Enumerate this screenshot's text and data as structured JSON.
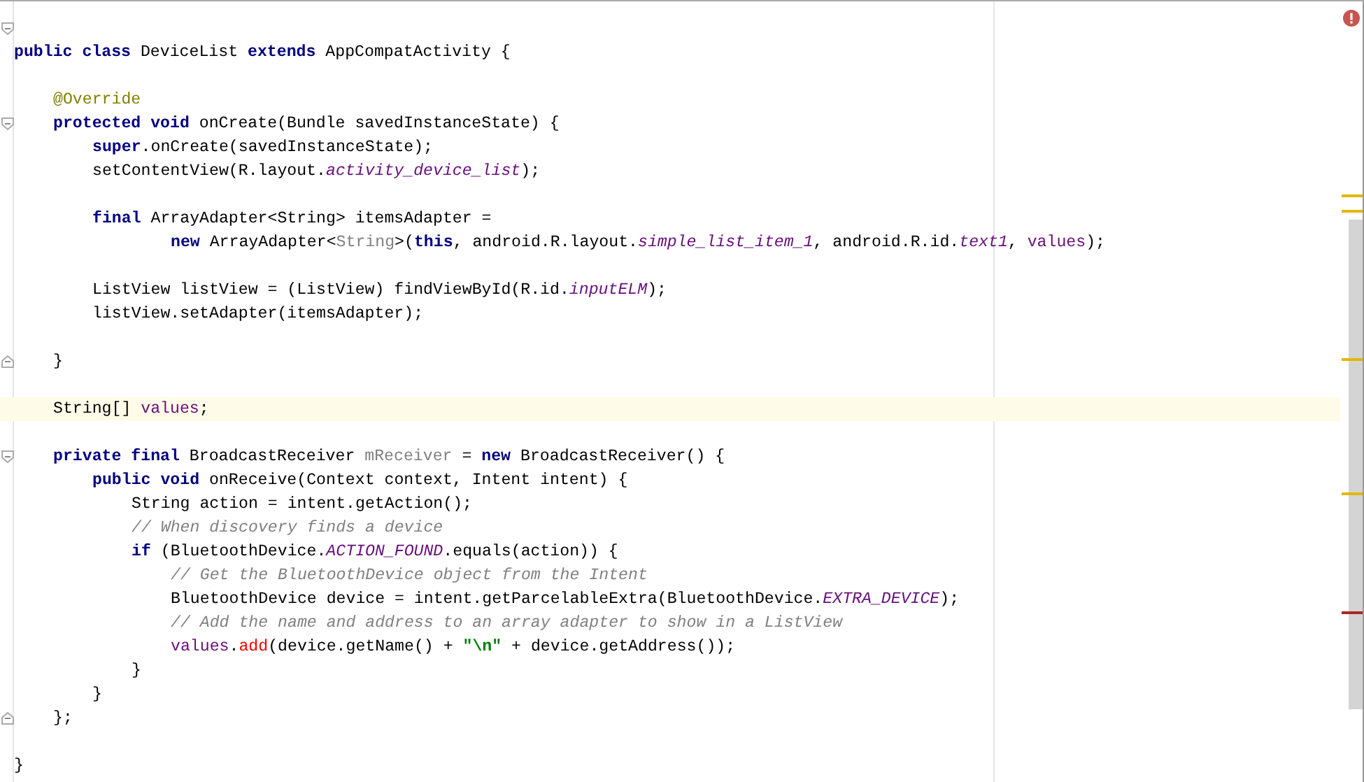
{
  "editor": {
    "lines": [
      {
        "kind": "opener",
        "current": false
      },
      {
        "kind": "code",
        "current": false,
        "tokens": [
          {
            "t": "public class ",
            "kind": "keyword"
          },
          {
            "t": "DeviceList ",
            "kind": "plain"
          },
          {
            "t": "extends ",
            "kind": "keyword"
          },
          {
            "t": "AppCompatActivity {",
            "kind": "plain"
          }
        ],
        "children": [
          {
            "kind": "blank",
            "current": false
          },
          {
            "kind": "code",
            "current": false,
            "tokens": [
              {
                "t": "@Override",
                "kind": "annotation"
              }
            ]
          },
          {
            "kind": "opener",
            "current": false,
            "tokens": [
              {
                "t": "protected void ",
                "kind": "keyword"
              },
              {
                "t": "onCreate(Bundle savedInstanceState) {",
                "kind": "plain"
              }
            ],
            "children": [
              {
                "kind": "code",
                "current": false,
                "tokens": [
                  {
                    "t": "super",
                    "kind": "keyword"
                  },
                  {
                    "t": ".onCreate(savedInstanceState);",
                    "kind": "plain"
                  }
                ]
              },
              {
                "kind": "code",
                "current": false,
                "tokens": [
                  {
                    "t": "setContentView(R.layout.",
                    "kind": "plain"
                  },
                  {
                    "t": "activity_device_list",
                    "kind": "static"
                  },
                  {
                    "t": ");",
                    "kind": "plain"
                  }
                ]
              },
              {
                "kind": "blank",
                "current": false
              },
              {
                "kind": "code",
                "current": false,
                "tokens": [
                  {
                    "t": "final ",
                    "kind": "keyword"
                  },
                  {
                    "t": "ArrayAdapter<String> itemsAdapter =",
                    "kind": "plain"
                  }
                ],
                "children": [
                  {
                    "kind": "continuation",
                    "current": false,
                    "tokens": [
                      {
                        "t": "new ",
                        "kind": "keyword"
                      },
                      {
                        "t": "ArrayAdapter<",
                        "kind": "plain"
                      },
                      {
                        "t": "String",
                        "kind": "muted"
                      },
                      {
                        "t": ">(",
                        "kind": "plain"
                      },
                      {
                        "t": "this",
                        "kind": "keyword"
                      },
                      {
                        "t": ", android.R.layout.",
                        "kind": "plain"
                      },
                      {
                        "t": "simple_list_item_1",
                        "kind": "static"
                      },
                      {
                        "t": ", android.R.id.",
                        "kind": "plain"
                      },
                      {
                        "t": "text1",
                        "kind": "static"
                      },
                      {
                        "t": ", ",
                        "kind": "plain"
                      },
                      {
                        "t": "values",
                        "kind": "field"
                      },
                      {
                        "t": ");",
                        "kind": "plain"
                      }
                    ]
                  }
                ]
              },
              {
                "kind": "blank",
                "current": false
              },
              {
                "kind": "code",
                "current": false,
                "tokens": [
                  {
                    "t": "ListView listView = (ListView) findViewById(R.id.",
                    "kind": "plain"
                  },
                  {
                    "t": "inputELM",
                    "kind": "static"
                  },
                  {
                    "t": ");",
                    "kind": "plain"
                  }
                ]
              },
              {
                "kind": "code",
                "current": false,
                "tokens": [
                  {
                    "t": "listView.setAdapter(itemsAdapter);",
                    "kind": "plain"
                  }
                ]
              },
              {
                "kind": "blank",
                "current": false
              }
            ]
          },
          {
            "kind": "closer",
            "current": false,
            "tokens": [
              {
                "t": "}",
                "kind": "plain"
              }
            ]
          },
          {
            "kind": "blank",
            "current": false
          },
          {
            "kind": "code",
            "current": true,
            "tokens": [
              {
                "t": "String[] ",
                "kind": "plain"
              },
              {
                "t": "values",
                "kind": "field"
              },
              {
                "t": ";",
                "kind": "plain"
              }
            ]
          },
          {
            "kind": "blank",
            "current": false
          },
          {
            "kind": "opener",
            "current": false,
            "tokens": [
              {
                "t": "private final ",
                "kind": "keyword"
              },
              {
                "t": "BroadcastReceiver ",
                "kind": "plain"
              },
              {
                "t": "mReceiver",
                "kind": "muted"
              },
              {
                "t": " = ",
                "kind": "plain"
              },
              {
                "t": "new ",
                "kind": "keyword"
              },
              {
                "t": "BroadcastReceiver() {",
                "kind": "plain"
              }
            ],
            "children": [
              {
                "kind": "code",
                "current": false,
                "tokens": [
                  {
                    "t": "public void ",
                    "kind": "keyword"
                  },
                  {
                    "t": "onReceive(Context context, Intent intent) {",
                    "kind": "plain"
                  }
                ],
                "children": [
                  {
                    "kind": "code",
                    "current": false,
                    "tokens": [
                      {
                        "t": "String action = intent.getAction();",
                        "kind": "plain"
                      }
                    ]
                  },
                  {
                    "kind": "code",
                    "current": false,
                    "tokens": [
                      {
                        "t": "// When discovery finds a device",
                        "kind": "comment"
                      }
                    ]
                  },
                  {
                    "kind": "code",
                    "current": false,
                    "tokens": [
                      {
                        "t": "if ",
                        "kind": "keyword"
                      },
                      {
                        "t": "(BluetoothDevice.",
                        "kind": "plain"
                      },
                      {
                        "t": "ACTION_FOUND",
                        "kind": "static"
                      },
                      {
                        "t": ".equals(action)) {",
                        "kind": "plain"
                      }
                    ],
                    "children": [
                      {
                        "kind": "code",
                        "current": false,
                        "tokens": [
                          {
                            "t": "// Get the BluetoothDevice object from the Intent",
                            "kind": "comment"
                          }
                        ]
                      },
                      {
                        "kind": "code",
                        "current": false,
                        "tokens": [
                          {
                            "t": "BluetoothDevice device = intent.getParcelableExtra(BluetoothDevice.",
                            "kind": "plain"
                          },
                          {
                            "t": "EXTRA_DEVICE",
                            "kind": "static"
                          },
                          {
                            "t": ");",
                            "kind": "plain"
                          }
                        ]
                      },
                      {
                        "kind": "code",
                        "current": false,
                        "tokens": [
                          {
                            "t": "// Add the name and address to an array adapter to show in a ListView",
                            "kind": "comment"
                          }
                        ]
                      },
                      {
                        "kind": "code",
                        "current": false,
                        "tokens": [
                          {
                            "t": "values",
                            "kind": "field"
                          },
                          {
                            "t": ".",
                            "kind": "plain"
                          },
                          {
                            "t": "add",
                            "kind": "error"
                          },
                          {
                            "t": "(device.getName() + ",
                            "kind": "plain"
                          },
                          {
                            "t": "\"\\n\"",
                            "kind": "string"
                          },
                          {
                            "t": " + device.getAddress());",
                            "kind": "plain"
                          }
                        ]
                      }
                    ]
                  },
                  {
                    "kind": "code",
                    "current": false,
                    "tokens": [
                      {
                        "t": "}",
                        "kind": "plain"
                      }
                    ]
                  }
                ]
              },
              {
                "kind": "code",
                "current": false,
                "tokens": [
                  {
                    "t": "}",
                    "kind": "plain"
                  }
                ]
              }
            ]
          },
          {
            "kind": "closer",
            "current": false,
            "tokens": [
              {
                "t": "};",
                "kind": "plain"
              }
            ]
          },
          {
            "kind": "blank",
            "current": false
          }
        ]
      },
      {
        "kind": "code",
        "current": false,
        "tokens": [
          {
            "t": "}",
            "kind": "plain"
          }
        ]
      }
    ]
  }
}
